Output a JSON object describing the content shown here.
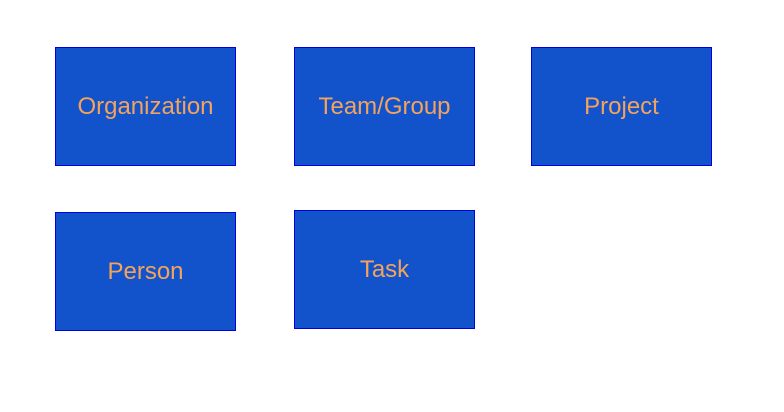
{
  "diagram": {
    "colors": {
      "box_fill": "#1253cc",
      "box_border": "#0000e0",
      "label_text": "#f5a35a",
      "background": "#ffffff"
    },
    "entities": [
      {
        "id": "organization",
        "label": "Organization"
      },
      {
        "id": "team-group",
        "label": "Team/Group"
      },
      {
        "id": "project",
        "label": "Project"
      },
      {
        "id": "person",
        "label": "Person"
      },
      {
        "id": "task",
        "label": "Task"
      }
    ]
  }
}
